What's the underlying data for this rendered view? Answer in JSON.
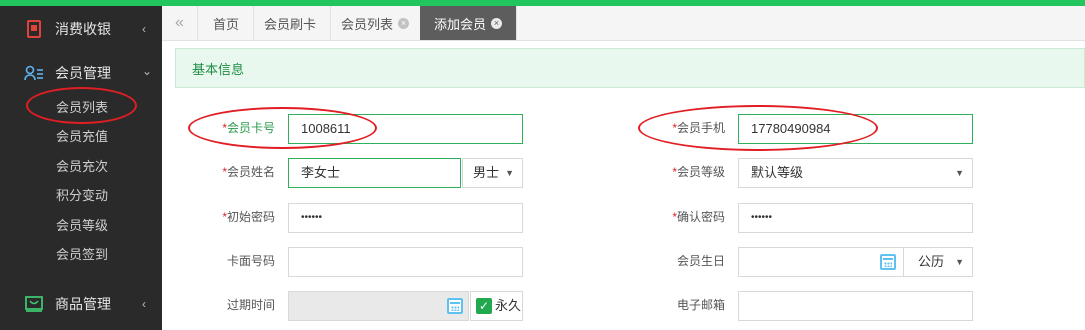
{
  "sidebar": {
    "groups": [
      {
        "label": "消费收银",
        "icon": "cashier-icon",
        "arrow": "‹"
      },
      {
        "label": "会员管理",
        "icon": "member-icon",
        "arrow": "⌄"
      },
      {
        "label": "商品管理",
        "icon": "goods-icon",
        "arrow": "‹"
      }
    ],
    "member_items": [
      "会员列表",
      "会员充值",
      "会员充次",
      "积分变动",
      "会员等级",
      "会员签到"
    ]
  },
  "tabs": {
    "nav_left": "«",
    "items": [
      {
        "label": "首页"
      },
      {
        "label": "会员刷卡"
      },
      {
        "label": "会员列表",
        "close": "×"
      },
      {
        "label": "添加会员",
        "close": "×"
      }
    ]
  },
  "section_title": "基本信息",
  "form": {
    "card_no": {
      "label": "会员卡号",
      "value": "1008611"
    },
    "phone": {
      "label": "会员手机",
      "value": "17780490984"
    },
    "name": {
      "label": "会员姓名",
      "value": "李女士",
      "gender": "男士"
    },
    "level": {
      "label": "会员等级",
      "value": "默认等级"
    },
    "init_password": {
      "label": "初始密码",
      "value": "••••••"
    },
    "confirm_password": {
      "label": "确认密码",
      "value": "••••••"
    },
    "card_face_no": {
      "label": "卡面号码",
      "value": ""
    },
    "birthday": {
      "label": "会员生日",
      "value": "",
      "calendar_type": "公历"
    },
    "expire": {
      "label": "过期时间",
      "value": "",
      "forever_label": "永久"
    },
    "email": {
      "label": "电子邮箱",
      "value": ""
    },
    "required_mark": "*"
  },
  "colors": {
    "accent": "#23c55e",
    "sidebar": "#2a2a2a",
    "annotation": "#e01e24"
  }
}
